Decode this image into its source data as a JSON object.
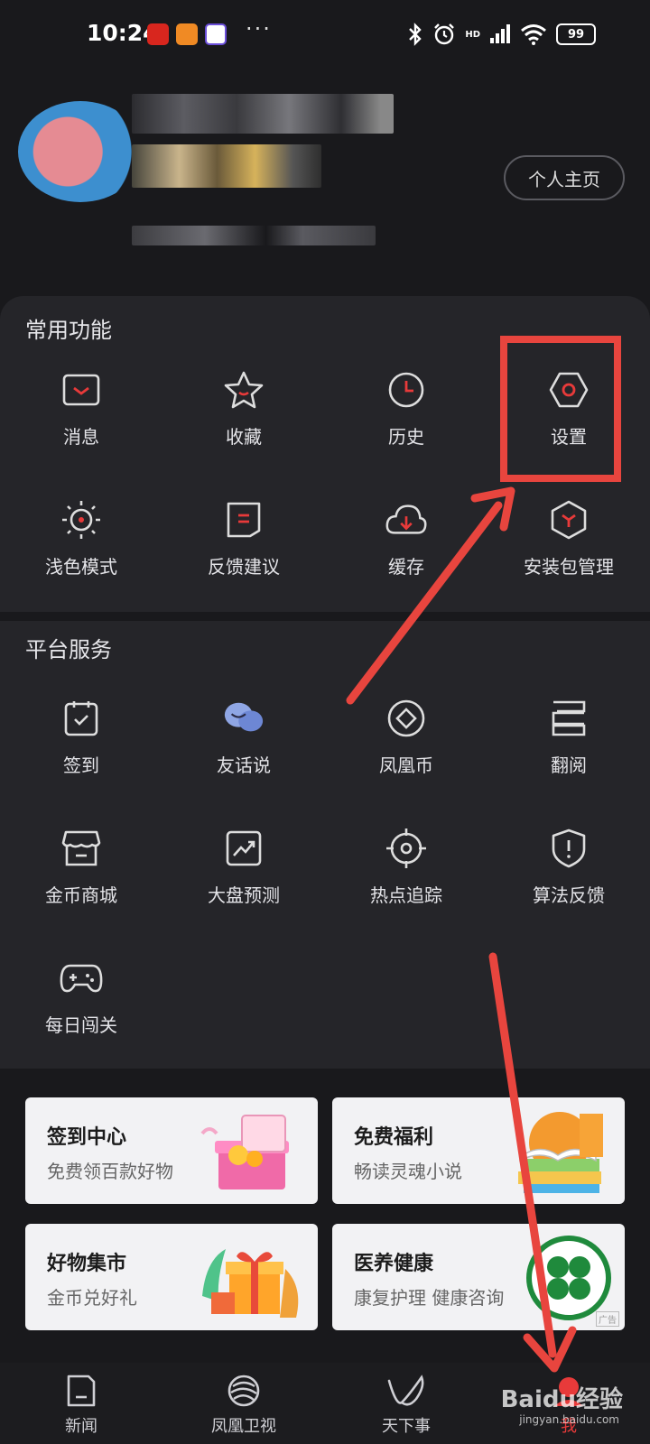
{
  "status_bar": {
    "time": "10:24",
    "dots": "···",
    "network": "HD",
    "battery": "99",
    "icons": [
      "bluetooth-icon",
      "alarm-icon",
      "signal-icon",
      "wifi-icon",
      "battery-icon"
    ]
  },
  "profile": {
    "home_button": "个人主页"
  },
  "common": {
    "title": "常用功能",
    "items": [
      {
        "label": "消息",
        "icon": "message-icon"
      },
      {
        "label": "收藏",
        "icon": "star-icon"
      },
      {
        "label": "历史",
        "icon": "clock-icon"
      },
      {
        "label": "设置",
        "icon": "gear-icon"
      },
      {
        "label": "浅色模式",
        "icon": "sun-icon"
      },
      {
        "label": "反馈建议",
        "icon": "feedback-icon"
      },
      {
        "label": "缓存",
        "icon": "cloud-download-icon"
      },
      {
        "label": "安装包管理",
        "icon": "package-icon"
      }
    ]
  },
  "platform": {
    "title": "平台服务",
    "items": [
      {
        "label": "签到",
        "icon": "checkin-icon"
      },
      {
        "label": "友话说",
        "icon": "chat-icon"
      },
      {
        "label": "凤凰币",
        "icon": "coin-icon"
      },
      {
        "label": "翻阅",
        "icon": "book-icon"
      },
      {
        "label": "金币商城",
        "icon": "store-icon"
      },
      {
        "label": "大盘预测",
        "icon": "chart-icon"
      },
      {
        "label": "热点追踪",
        "icon": "target-icon"
      },
      {
        "label": "算法反馈",
        "icon": "shield-icon"
      },
      {
        "label": "每日闯关",
        "icon": "gamepad-icon"
      }
    ]
  },
  "promos": [
    {
      "title": "签到中心",
      "subtitle": "免费领百款好物"
    },
    {
      "title": "免费福利",
      "subtitle": "畅读灵魂小说"
    },
    {
      "title": "好物集市",
      "subtitle": "金币兑好礼"
    },
    {
      "title": "医养健康",
      "subtitle": "康复护理 健康咨询",
      "ad_tag": "广告"
    }
  ],
  "nav": [
    {
      "label": "新闻",
      "icon": "news-icon"
    },
    {
      "label": "凤凰卫视",
      "icon": "phoenix-icon"
    },
    {
      "label": "天下事",
      "icon": "world-icon"
    },
    {
      "label": "我",
      "icon": "me-icon",
      "active": true
    }
  ],
  "watermark": {
    "brand": "Baidu经验",
    "url": "jingyan.baidu.com"
  },
  "colors": {
    "accent": "#e83a3a",
    "background": "#19191c",
    "card": "#252529"
  }
}
